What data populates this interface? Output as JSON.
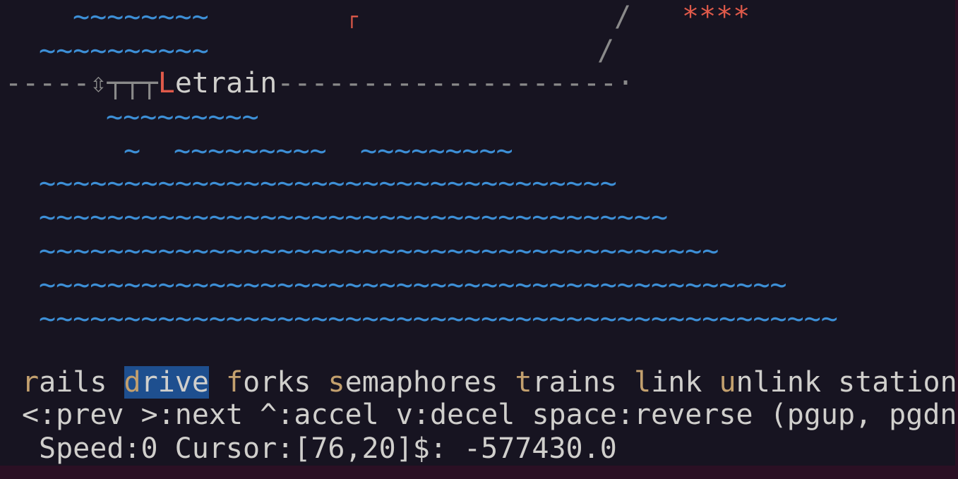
{
  "scene": {
    "row1_water": "~~~~~~~~",
    "row1_flag": "┌",
    "row1_slash": "/",
    "row1_stars": "****",
    "row2_water": "~~~~~~~~~~",
    "row2_slash": "/",
    "row3_track_left": "-----",
    "row3_engine": "⇳┬┬┬",
    "row3_train_first": "L",
    "row3_train_rest": "etrain",
    "row3_track_right": "--------------------·",
    "row4_water": "~~~~~~~~~",
    "row5_water_a": "~",
    "row5_water_b": "~~~~~~~~~",
    "row5_water_c": "~~~~~~~~~",
    "sea": [
      "~~~~~~~~~~~~~~~~~~~~~~~~~~~~~~~~~~",
      "~~~~~~~~~~~~~~~~~~~~~~~~~~~~~~~~~~~~~",
      "~~~~~~~~~~~~~~~~~~~~~~~~~~~~~~~~~~~~~~~~",
      "~~~~~~~~~~~~~~~~~~~~~~~~~~~~~~~~~~~~~~~~~~~~",
      "~~~~~~~~~~~~~~~~~~~~~~~~~~~~~~~~~~~~~~~~~~~~~~~"
    ]
  },
  "menu": {
    "items": [
      {
        "hot": "r",
        "rest": "ails"
      },
      {
        "hot": "d",
        "rest": "rive"
      },
      {
        "hot": "f",
        "rest": "orks"
      },
      {
        "hot": "s",
        "rest": "emaphores"
      },
      {
        "hot": "t",
        "rest": "rains"
      },
      {
        "hot": "l",
        "rest": "ink"
      },
      {
        "hot": "u",
        "rest": "nlink"
      },
      {
        "hot": "",
        "rest": "station"
      }
    ],
    "selected": "drive"
  },
  "help_line": "<:prev >:next ^:accel v:decel space:reverse (pgup, pgdn",
  "status_line": "Speed:0 Cursor:[76,20]$: -577430.0",
  "colors": {
    "background": "#171421",
    "water": "#3d8fd6",
    "accent_red": "#e05a4a",
    "hotkey": "#c3a06e",
    "selection": "#1e4f8f",
    "text": "#d0cfcc"
  }
}
